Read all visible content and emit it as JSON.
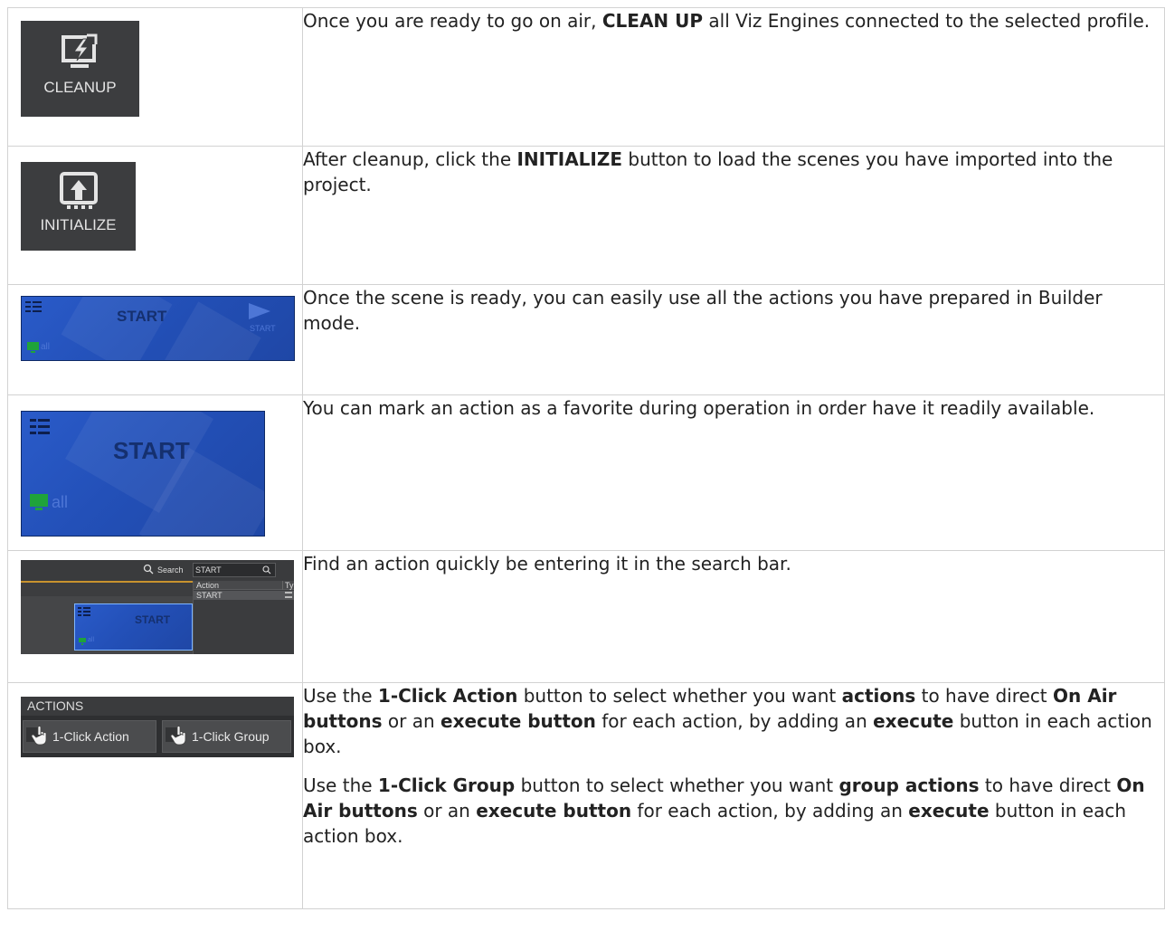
{
  "rows": [
    {
      "icon": "cleanup-icon",
      "icon_label": "CLEANUP",
      "text": [
        {
          "t": "Once you are ready to go on air, "
        },
        {
          "t": "CLEAN UP",
          "b": true
        },
        {
          "t": " all Viz Engines connected to the selected profile."
        }
      ]
    },
    {
      "icon": "initialize-icon",
      "icon_label": "INITIALIZE",
      "text": [
        {
          "t": "After cleanup, click the "
        },
        {
          "t": "INITIALIZE",
          "b": true
        },
        {
          "t": " button to load the scenes you have imported into the project."
        }
      ]
    },
    {
      "card_title": "START",
      "card_sub": "START",
      "card_all": "all",
      "text": [
        {
          "t": "Once the scene is ready, you can easily use all the actions you have prepared in Builder mode."
        }
      ]
    },
    {
      "card_title": "START",
      "card_all": "all",
      "text": [
        {
          "t": "You can mark an action as a favorite during operation in order have it readily available."
        }
      ]
    },
    {
      "search_label": "Search",
      "search_value": "START",
      "col_action": "Action",
      "col_type": "Typ",
      "result": "START",
      "card_title": "START",
      "card_all": "all",
      "text": [
        {
          "t": "Find an action quickly be entering it in the search bar."
        }
      ]
    },
    {
      "header": "ACTIONS",
      "btn1": "1-Click Action",
      "btn2": "1-Click Group",
      "paragraphs": [
        [
          {
            "t": "Use the "
          },
          {
            "t": "1-Click Action",
            "b": true
          },
          {
            "t": " button to select whether you want "
          },
          {
            "t": "actions",
            "b": true
          },
          {
            "t": " to have direct "
          },
          {
            "t": "On Air buttons",
            "b": true
          },
          {
            "t": " or an "
          },
          {
            "t": "execute button",
            "b": true
          },
          {
            "t": " for each action, by adding an "
          },
          {
            "t": "execute",
            "b": true
          },
          {
            "t": " button in each action box."
          }
        ],
        [
          {
            "t": "Use the "
          },
          {
            "t": "1-Click Group",
            "b": true
          },
          {
            "t": " button to select whether you want "
          },
          {
            "t": "group actions",
            "b": true
          },
          {
            "t": " to have direct "
          },
          {
            "t": "On Air buttons",
            "b": true
          },
          {
            "t": " or an "
          },
          {
            "t": "execute button",
            "b": true
          },
          {
            "t": " for each action, by adding an "
          },
          {
            "t": "execute",
            "b": true
          },
          {
            "t": " button in each action box."
          }
        ]
      ]
    }
  ]
}
